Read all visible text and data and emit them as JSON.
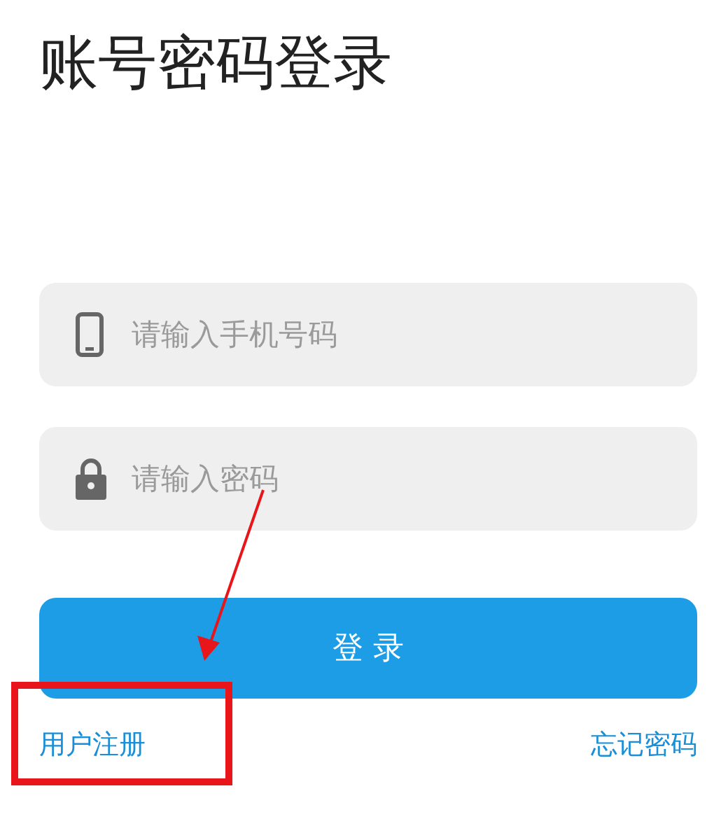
{
  "title": "账号密码登录",
  "fields": [
    {
      "kind": "phone",
      "placeholder": "请输入手机号码"
    },
    {
      "kind": "password",
      "placeholder": "请输入密码"
    }
  ],
  "login_button": "登 录",
  "links": {
    "register": "用户注册",
    "forgot": "忘记密码"
  }
}
